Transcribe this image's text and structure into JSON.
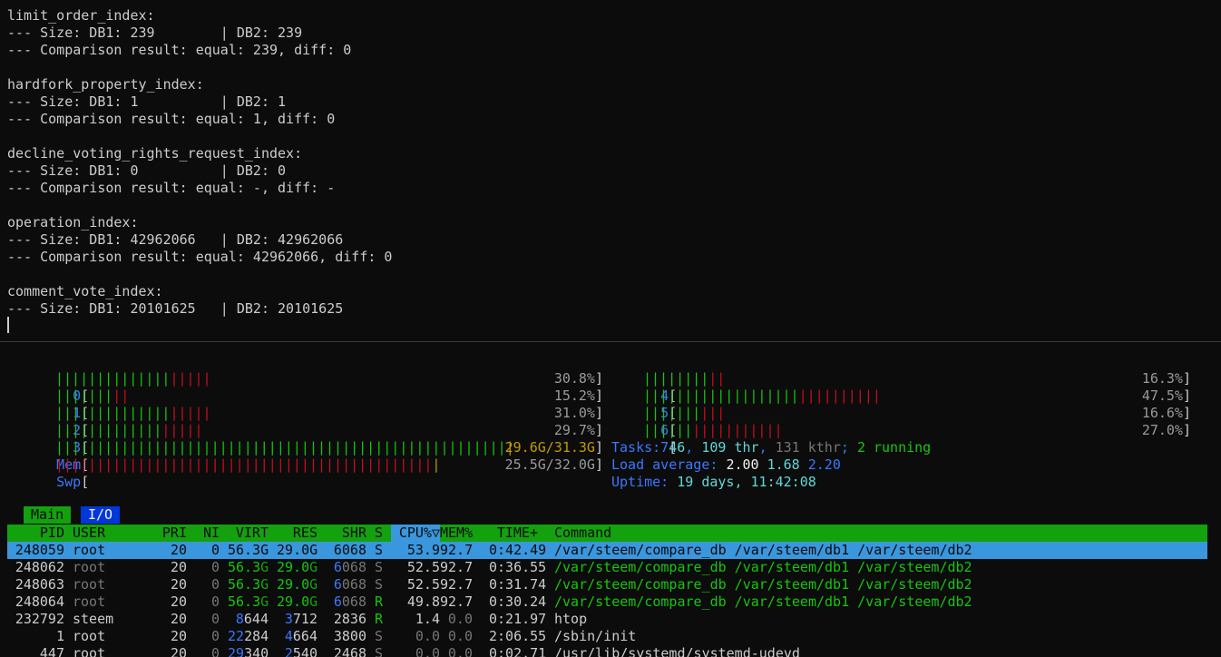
{
  "comparison_log": {
    "lines": [
      "limit_order_index:",
      "--- Size: DB1: 239        | DB2: 239",
      "--- Comparison result: equal: 239, diff: 0",
      "",
      "hardfork_property_index:",
      "--- Size: DB1: 1          | DB2: 1",
      "--- Comparison result: equal: 1, diff: 0",
      "",
      "decline_voting_rights_request_index:",
      "--- Size: DB1: 0          | DB2: 0",
      "--- Comparison result: equal: -, diff: -",
      "",
      "operation_index:",
      "--- Size: DB1: 42962066   | DB2: 42962066",
      "--- Comparison result: equal: 42962066, diff: 0",
      "",
      "comment_vote_index:",
      "--- Size: DB1: 20101625   | DB2: 20101625"
    ]
  },
  "htop": {
    "cpus": [
      {
        "label": "0",
        "percent": "30.8%",
        "value": 30.8,
        "normal_frac": 0.73
      },
      {
        "label": "1",
        "percent": "15.2%",
        "value": 15.2,
        "normal_frac": 0.83
      },
      {
        "label": "2",
        "percent": "31.0%",
        "value": 31.0,
        "normal_frac": 0.74
      },
      {
        "label": "3",
        "percent": "29.7%",
        "value": 29.7,
        "normal_frac": 0.73
      },
      {
        "label": "4",
        "percent": "16.3%",
        "value": 16.3,
        "normal_frac": 0.78
      },
      {
        "label": "5",
        "percent": "47.5%",
        "value": 47.5,
        "normal_frac": 0.66
      },
      {
        "label": "6",
        "percent": "16.6%",
        "value": 16.6,
        "normal_frac": 0.69
      },
      {
        "label": "7",
        "percent": "27.0%",
        "value": 27.0,
        "normal_frac": 0.35
      }
    ],
    "mem": {
      "label": "Mem",
      "text": "29.6G/31.3G",
      "used_frac": 0.946
    },
    "swp": {
      "label": "Swp",
      "text": "25.5G/32.0G",
      "used_frac": 0.797
    },
    "tasks": {
      "label": "Tasks: ",
      "count": "46",
      "sep1": ", ",
      "thr": "109 thr",
      "sep2": ", ",
      "kthr": "131 kthr",
      "sep3": "; ",
      "running": "2 running"
    },
    "load": {
      "label": "Load average: ",
      "one": "2.00",
      "five": "1.68",
      "fifteen": "2.20"
    },
    "uptime": {
      "label": "Uptime: ",
      "value": "19 days, 11:42:08"
    },
    "tabs": {
      "main": "Main",
      "io": "I/O"
    },
    "columns": {
      "pid": "PID",
      "user": "USER",
      "pri": "PRI",
      "ni": "NI",
      "virt": "VIRT",
      "res": "RES",
      "shr": "SHR",
      "s": "S",
      "cpu": "CPU%▽",
      "mem": "MEM%",
      "time": "TIME+",
      "command": "Command"
    },
    "processes": [
      {
        "pid": "248059",
        "user": "root",
        "pri": "20",
        "ni": "0",
        "virt_a": "56.3",
        "virt_b": "G",
        "res_a": "29.0",
        "res_b": "G",
        "shr_a": "",
        "shr_b": "6068",
        "s": "S",
        "cpu": "53.9",
        "mem": "92.7",
        "time": "0:42.49",
        "command": "/var/steem/compare_db /var/steem/db1 /var/steem/db2",
        "selected": true,
        "thread": false
      },
      {
        "pid": "248062",
        "user": "root",
        "pri": "20",
        "ni": "0",
        "virt_a": "56.3",
        "virt_b": "G",
        "res_a": "29.0",
        "res_b": "G",
        "shr_a": "6",
        "shr_b": "068",
        "s": "S",
        "cpu": "52.5",
        "mem": "92.7",
        "time": "0:36.55",
        "command": "/var/steem/compare_db /var/steem/db1 /var/steem/db2",
        "selected": false,
        "thread": true
      },
      {
        "pid": "248063",
        "user": "root",
        "pri": "20",
        "ni": "0",
        "virt_a": "56.3",
        "virt_b": "G",
        "res_a": "29.0",
        "res_b": "G",
        "shr_a": "6",
        "shr_b": "068",
        "s": "S",
        "cpu": "52.5",
        "mem": "92.7",
        "time": "0:31.74",
        "command": "/var/steem/compare_db /var/steem/db1 /var/steem/db2",
        "selected": false,
        "thread": true
      },
      {
        "pid": "248064",
        "user": "root",
        "pri": "20",
        "ni": "0",
        "virt_a": "56.3",
        "virt_b": "G",
        "res_a": "29.0",
        "res_b": "G",
        "shr_a": "6",
        "shr_b": "068",
        "s": "R",
        "cpu": "49.8",
        "mem": "92.7",
        "time": "0:30.24",
        "command": "/var/steem/compare_db /var/steem/db1 /var/steem/db2",
        "selected": false,
        "thread": true
      },
      {
        "pid": "232792",
        "user": "steem",
        "pri": "20",
        "ni": "0",
        "virt_a": "8",
        "virt_b": "644",
        "res_a": "3",
        "res_b": "712",
        "shr_a": "",
        "shr_b": "2836",
        "s": "R",
        "cpu": "1.4",
        "mem": "0.0",
        "time": "0:21.97",
        "command": "htop",
        "selected": false,
        "thread": false
      },
      {
        "pid": "1",
        "user": "root",
        "pri": "20",
        "ni": "0",
        "virt_a": "22",
        "virt_b": "284",
        "res_a": "4",
        "res_b": "664",
        "shr_a": "",
        "shr_b": "3800",
        "s": "S",
        "cpu": "0.0",
        "mem": "0.0",
        "time": "2:06.55",
        "command": "/sbin/init",
        "selected": false,
        "thread": false
      },
      {
        "pid": "447",
        "user": "root",
        "pri": "20",
        "ni": "0",
        "virt_a": "29",
        "virt_b": "340",
        "res_a": "2",
        "res_b": "540",
        "shr_a": "",
        "shr_b": "2468",
        "s": "S",
        "cpu": "0.0",
        "mem": "0.0",
        "time": "0:02.71",
        "command": "/usr/lib/systemd/systemd-udevd",
        "selected": false,
        "thread": false
      }
    ]
  },
  "colors": {
    "background": "#0c0c0c",
    "text": "#cccccc",
    "meter_green": "#16c60c",
    "meter_red": "#c50f1f",
    "header_green": "#13a10e",
    "selection_blue": "#3a96dd",
    "label_blue": "#3b78ff",
    "cyan": "#61d6d6"
  }
}
